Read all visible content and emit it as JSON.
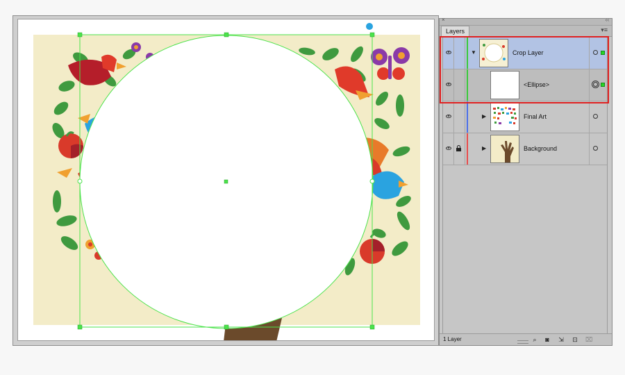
{
  "panel": {
    "close_glyph": "×",
    "collapse_glyph": "‹‹",
    "tab_label": "Layers",
    "menu_glyph": "▾≡",
    "footer_label": "1 Layer",
    "footer_icons": [
      "search-icon",
      "make-clip-mask-icon",
      "sublayer-icon",
      "new-layer-icon",
      "delete-icon"
    ]
  },
  "layers": [
    {
      "name": "Crop Layer",
      "expanded": true,
      "selected": true,
      "color": "#39c939",
      "locked": false,
      "target": "circle",
      "selected_art": true
    },
    {
      "name": "<Ellipse>",
      "sublayer": true,
      "color": "#39c939",
      "locked": false,
      "target": "double-circle",
      "selected_art": true
    },
    {
      "name": "Final Art",
      "expanded": false,
      "color": "#4a6fe8",
      "locked": false,
      "target": "circle"
    },
    {
      "name": "Background",
      "expanded": false,
      "color": "#e84a4a",
      "locked": true,
      "target": "circle"
    }
  ],
  "glyphs": {
    "expanded": "▼",
    "collapsed": "▶"
  },
  "colors": {
    "selection_green": "#4be34b",
    "highlight_red": "#e02020",
    "art_background": "#f3ecc8",
    "trunk": "#6b4a2b"
  }
}
